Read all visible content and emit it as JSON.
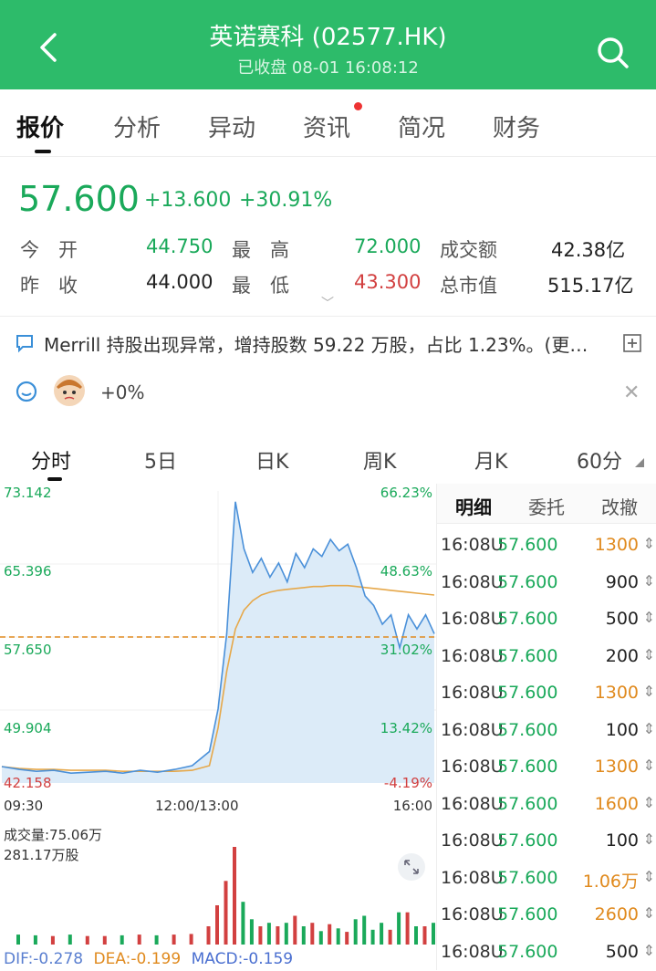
{
  "header": {
    "title": "英诺赛科 (02577.HK)",
    "subtitle": "已收盘 08-01 16:08:12"
  },
  "tabs": [
    "报价",
    "分析",
    "异动",
    "资讯",
    "简况",
    "财务"
  ],
  "quote": {
    "price": "57.600",
    "change": "+13.600",
    "change_pct": "+30.91%",
    "open_label": "今　开",
    "open": "44.750",
    "high_label": "最　高",
    "high": "72.000",
    "turnover_label": "成交额",
    "turnover": "42.38亿",
    "prev_close_label": "昨　收",
    "prev_close": "44.000",
    "low_label": "最　低",
    "low": "43.300",
    "market_cap_label": "总市值",
    "market_cap": "515.17亿"
  },
  "news": {
    "text": "Merrill 持股出现异常，增持股数 59.22 万股，占比 1.23%。(更…"
  },
  "social": {
    "pct": "+0%"
  },
  "periods": [
    "分时",
    "5日",
    "日K",
    "周K",
    "月K",
    "60分"
  ],
  "ticks_panel": {
    "headers": [
      "明细",
      "委托",
      "改撤"
    ],
    "rows": [
      {
        "time": "16:08U",
        "price": "57.600",
        "vol": "1300",
        "color": "#e08a1e"
      },
      {
        "time": "16:08U",
        "price": "57.600",
        "vol": "900",
        "color": "#222222"
      },
      {
        "time": "16:08U",
        "price": "57.600",
        "vol": "500",
        "color": "#222222"
      },
      {
        "time": "16:08U",
        "price": "57.600",
        "vol": "200",
        "color": "#222222"
      },
      {
        "time": "16:08U",
        "price": "57.600",
        "vol": "1300",
        "color": "#e08a1e"
      },
      {
        "time": "16:08U",
        "price": "57.600",
        "vol": "100",
        "color": "#222222"
      },
      {
        "time": "16:08U",
        "price": "57.600",
        "vol": "1300",
        "color": "#e08a1e"
      },
      {
        "time": "16:08U",
        "price": "57.600",
        "vol": "1600",
        "color": "#e08a1e"
      },
      {
        "time": "16:08U",
        "price": "57.600",
        "vol": "100",
        "color": "#222222"
      },
      {
        "time": "16:08U",
        "price": "57.600",
        "vol": "1.06万",
        "color": "#e08a1e"
      },
      {
        "time": "16:08U",
        "price": "57.600",
        "vol": "2600",
        "color": "#e08a1e"
      },
      {
        "time": "16:08U",
        "price": "57.600",
        "vol": "500",
        "color": "#222222"
      }
    ]
  },
  "chart_labels": {
    "y_left": [
      "73.142",
      "65.396",
      "57.650",
      "49.904",
      "42.158"
    ],
    "y_right": [
      "66.23%",
      "48.63%",
      "31.02%",
      "13.42%",
      "-4.19%"
    ],
    "x": [
      "09:30",
      "12:00/13:00",
      "16:00"
    ],
    "volume_label": "成交量:75.06万",
    "volume_max": "281.17万股",
    "macd": {
      "dif": "DIF:-0.278",
      "dea": "DEA:-0.199",
      "macd": "MACD:-0.159"
    }
  },
  "chart_data": {
    "type": "line",
    "title": "",
    "ylim": [
      42.158,
      73.142
    ],
    "prev_close": 44.0,
    "x": [
      0,
      4,
      8,
      12,
      16,
      20,
      24,
      28,
      32,
      36,
      40,
      44,
      48,
      50,
      52,
      54,
      56,
      58,
      60,
      62,
      64,
      66,
      68,
      70,
      72,
      74,
      76,
      78,
      80,
      82,
      84,
      86,
      88,
      90,
      92,
      94,
      96,
      98,
      100
    ],
    "series": [
      {
        "values": [
          43.9,
          43.6,
          43.4,
          43.5,
          43.2,
          43.3,
          43.4,
          43.2,
          43.5,
          43.3,
          43.6,
          44.0,
          45.5,
          50.0,
          58.0,
          72.0,
          67.0,
          64.5,
          66.0,
          64.0,
          65.5,
          63.5,
          66.5,
          65.0,
          67.0,
          66.2,
          68.0,
          66.8,
          67.5,
          65.0,
          62.0,
          61.0,
          59.0,
          60.0,
          56.5,
          60.0,
          58.5,
          60.0,
          58.0
        ]
      },
      {
        "values": [
          43.9,
          43.7,
          43.6,
          43.6,
          43.5,
          43.5,
          43.5,
          43.4,
          43.4,
          43.4,
          43.4,
          43.5,
          44.0,
          48.0,
          54.0,
          58.5,
          60.5,
          61.5,
          62.1,
          62.4,
          62.6,
          62.7,
          62.8,
          62.9,
          63.0,
          63.0,
          63.1,
          63.1,
          63.1,
          63.0,
          62.9,
          62.8,
          62.7,
          62.6,
          62.5,
          62.4,
          62.3,
          62.2,
          62.1
        ]
      }
    ]
  }
}
